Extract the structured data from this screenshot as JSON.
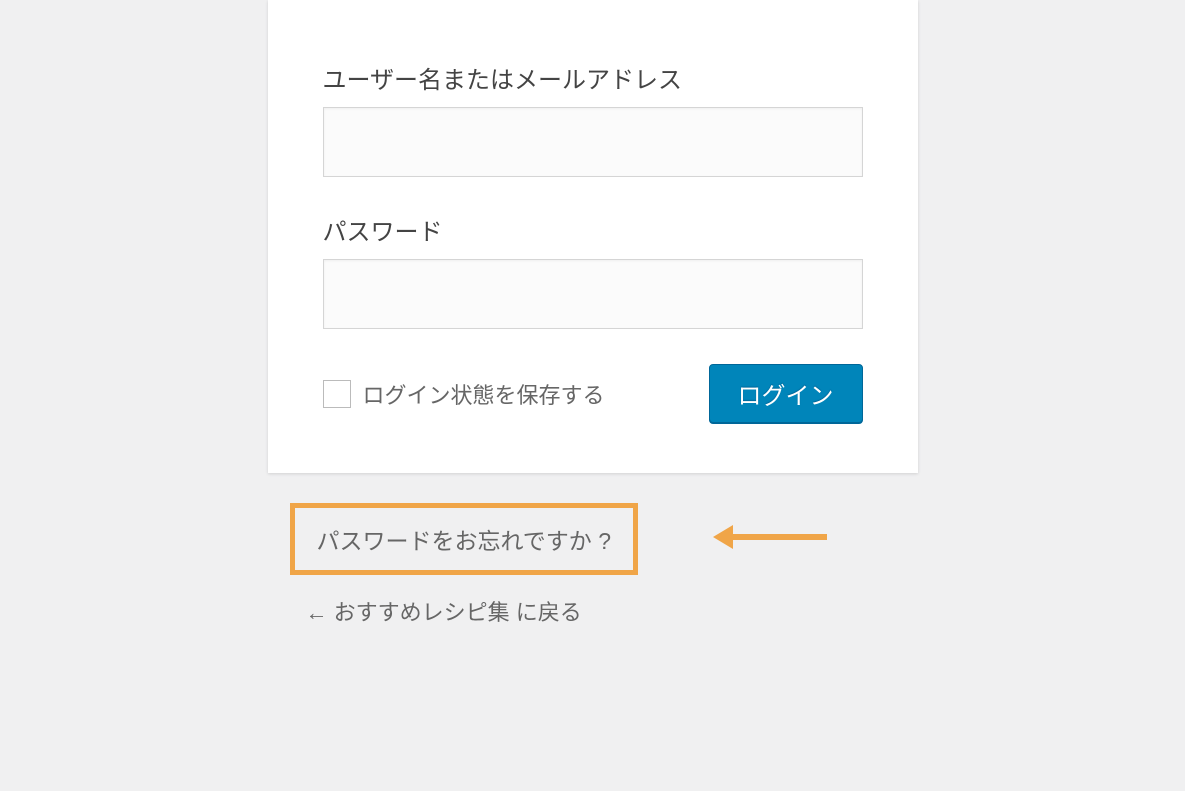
{
  "form": {
    "username_label": "ユーザー名またはメールアドレス",
    "username_value": "",
    "password_label": "パスワード",
    "password_value": "",
    "remember_label": "ログイン状態を保存する",
    "login_button": "ログイン"
  },
  "links": {
    "forgot_password": "パスワードをお忘れですか ?",
    "back_to_site": "← おすすめレシピ集 に戻る"
  },
  "annotation": {
    "highlight_color": "#f0a548"
  }
}
